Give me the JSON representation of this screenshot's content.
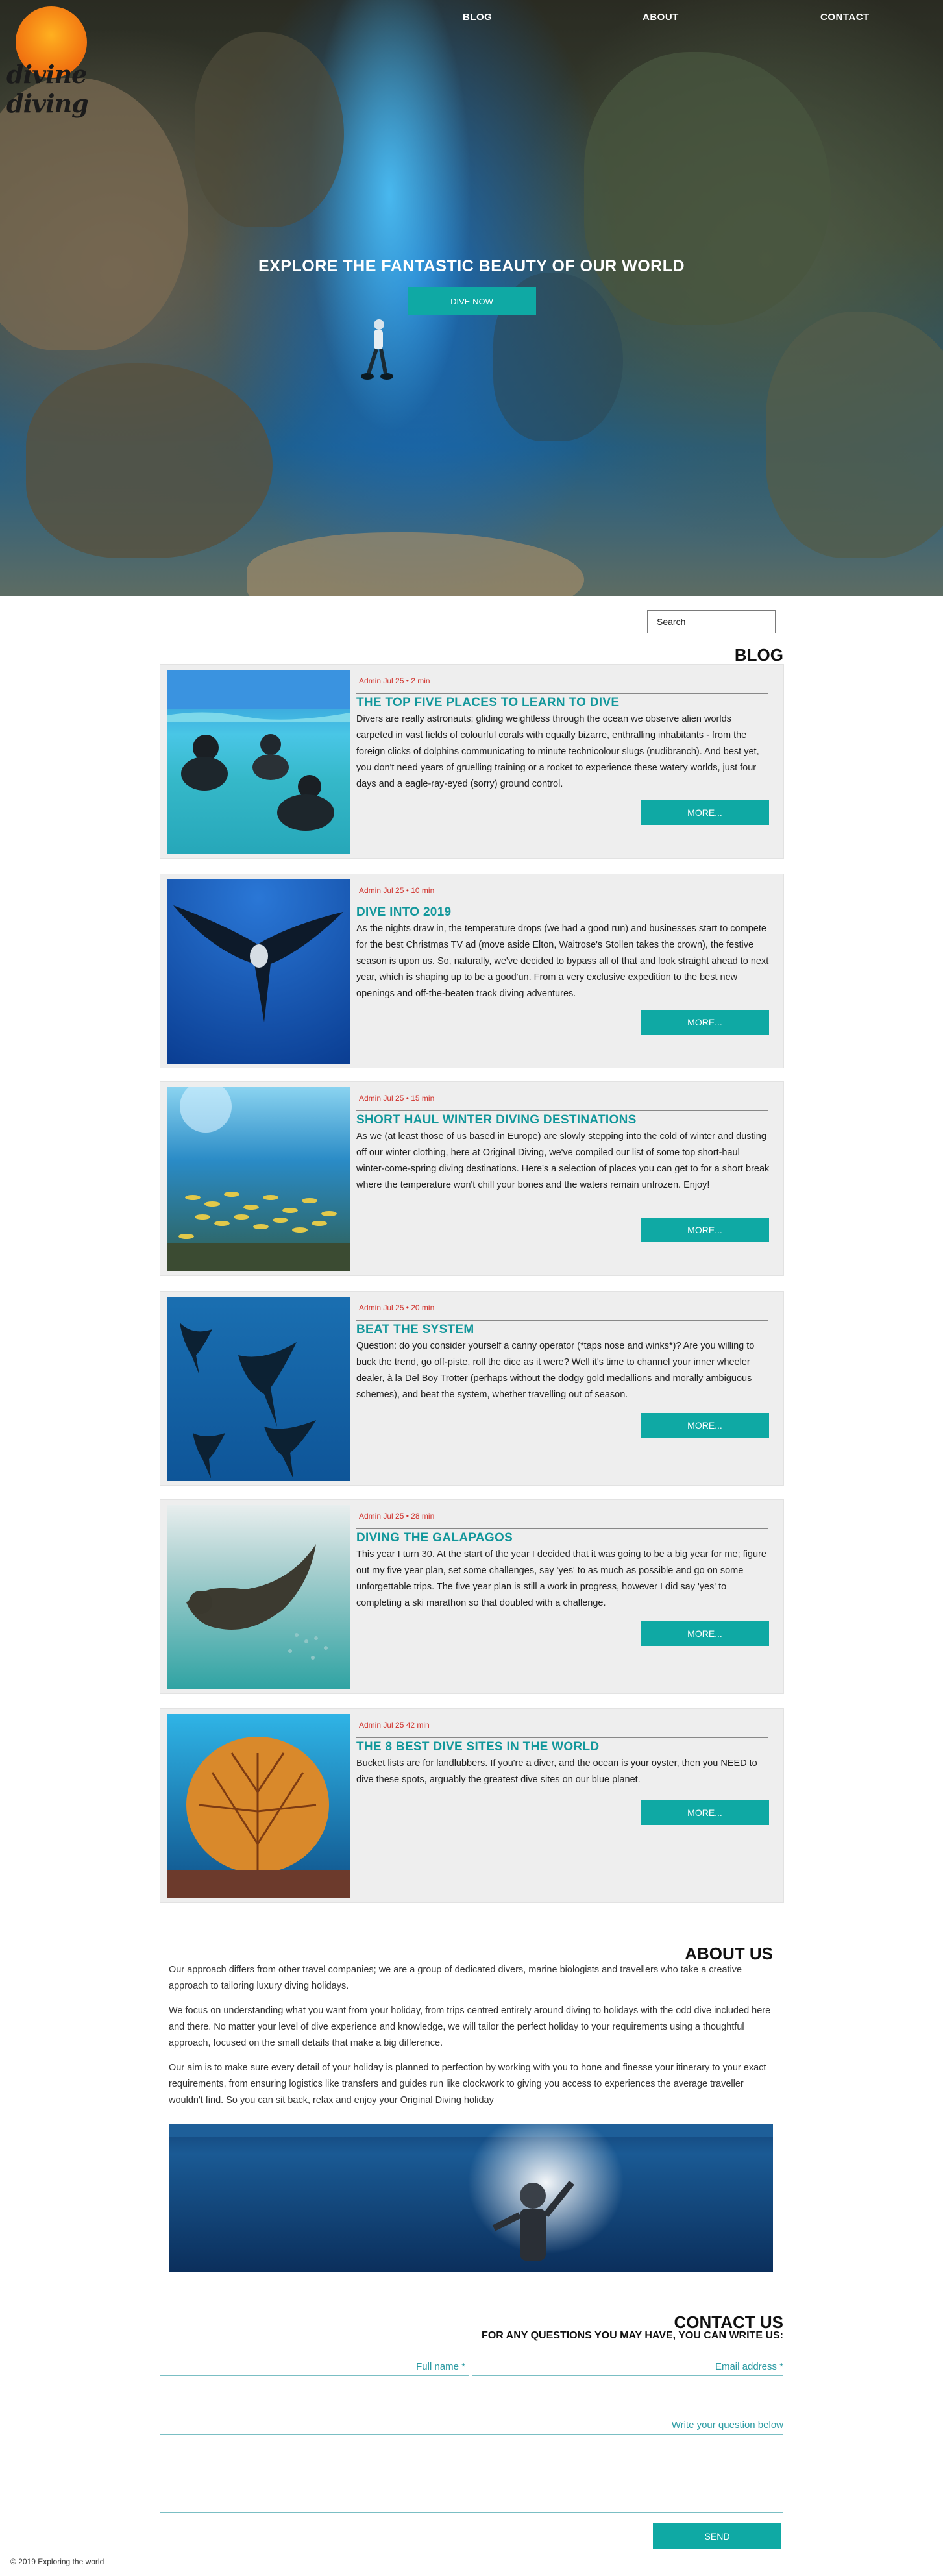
{
  "brand": {
    "name": "divine diving"
  },
  "nav": {
    "items": [
      "BLOG",
      "ABOUT",
      "CONTACT"
    ]
  },
  "hero": {
    "title": "EXPLORE THE FANTASTIC BEAUTY OF OUR WORLD",
    "button": "DIVE NOW"
  },
  "search": {
    "placeholder": "Search"
  },
  "blog": {
    "title": "BLOG",
    "more_label": "MORE...",
    "posts": [
      {
        "meta": "Admin Jul 25 • 2 min",
        "title": "THE TOP FIVE PLACES TO LEARN TO DIVE",
        "excerpt": "Divers are really astronauts; gliding weightless through the ocean we observe alien worlds carpeted in vast fields of colourful corals with equally bizarre, enthralling inhabitants - from the foreign clicks of dolphins communicating to minute technicolour slugs (nudibranch). And best yet, you don't need years of gruelling training or a rocket to experience these watery worlds, just four days and a eagle-ray-eyed (sorry) ground control."
      },
      {
        "meta": "Admin Jul 25 • 10 min",
        "title": "DIVE INTO 2019",
        "excerpt": "As the nights draw in, the temperature drops (we had a good run) and businesses start to compete for the best Christmas TV ad (move aside Elton, Waitrose's Stollen takes the crown), the festive season is upon us. So, naturally, we've decided to bypass all of that and look straight ahead to next year, which is shaping up to be a good'un. From a very exclusive expedition to the best new openings and off-the-beaten track diving adventures."
      },
      {
        "meta": "Admin Jul 25 • 15 min",
        "title": "SHORT HAUL WINTER DIVING DESTINATIONS",
        "excerpt": "As we (at least those of us based in Europe) are slowly stepping into the cold of winter and dusting off our winter clothing, here at Original Diving, we've compiled our list of some top short-haul winter-come-spring diving destinations. Here's a selection of places you can get to for a short break where the temperature won't chill your bones and the waters remain unfrozen. Enjoy!"
      },
      {
        "meta": "Admin Jul 25 • 20 min",
        "title": "BEAT THE SYSTEM",
        "excerpt": "Question: do you consider yourself a canny operator (*taps nose and winks*)? Are you willing to buck the trend, go off-piste, roll the dice as it were? Well it's time to channel your inner wheeler dealer, à la Del Boy Trotter (perhaps without the dodgy gold medallions and morally ambiguous schemes), and beat the system, whether travelling out of season."
      },
      {
        "meta": "Admin Jul 25 • 28 min",
        "title": "DIVING THE GALAPAGOS",
        "excerpt": "This year I turn 30. At the start of the year I decided that it was going to be a big year for me; figure out my five year plan, set some challenges, say 'yes' to as much as possible and go on some unforgettable trips. The five year plan is still a work in progress, however I did say 'yes' to completing a ski marathon so that doubled with a challenge."
      },
      {
        "meta": "Admin Jul 25 42 min",
        "title": "THE 8 BEST DIVE SITES IN THE WORLD",
        "excerpt": "Bucket lists are for landlubbers. If you're a diver, and the ocean is your oyster, then you NEED to dive these spots, arguably the greatest dive sites on our blue planet."
      }
    ]
  },
  "about": {
    "title": "ABOUT US",
    "paragraphs": [
      "Our approach differs from other travel companies; we are a group of dedicated divers, marine biologists and travellers who take a creative approach to tailoring luxury diving holidays.",
      "We focus on understanding what you want from your holiday, from trips centred entirely around diving to holidays with the odd dive included here and there. No matter your level of dive experience and knowledge, we will tailor the perfect holiday to your requirements using a thoughtful approach, focused on the small details that make a big difference.",
      "Our aim is to make sure every detail of your holiday is planned to perfection by working with you to hone and finesse your itinerary to your exact requirements, from ensuring logistics like transfers and guides run like clockwork to giving you access to experiences the average traveller wouldn't find. So you can sit back, relax and enjoy your Original Diving holiday"
    ]
  },
  "contact": {
    "title": "CONTACT US",
    "subtitle": "FOR ANY QUESTIONS YOU MAY HAVE, YOU CAN WRITE US:",
    "name_label": "Full name *",
    "email_label": "Email address *",
    "question_label": "Write your question below",
    "send_label": "SEND"
  },
  "footer": {
    "text": "© 2019 Exploring the world"
  },
  "colors": {
    "accent": "#0fa9a4",
    "title": "#12979b",
    "meta": "#d0302a",
    "panel": "#eeeeee"
  }
}
